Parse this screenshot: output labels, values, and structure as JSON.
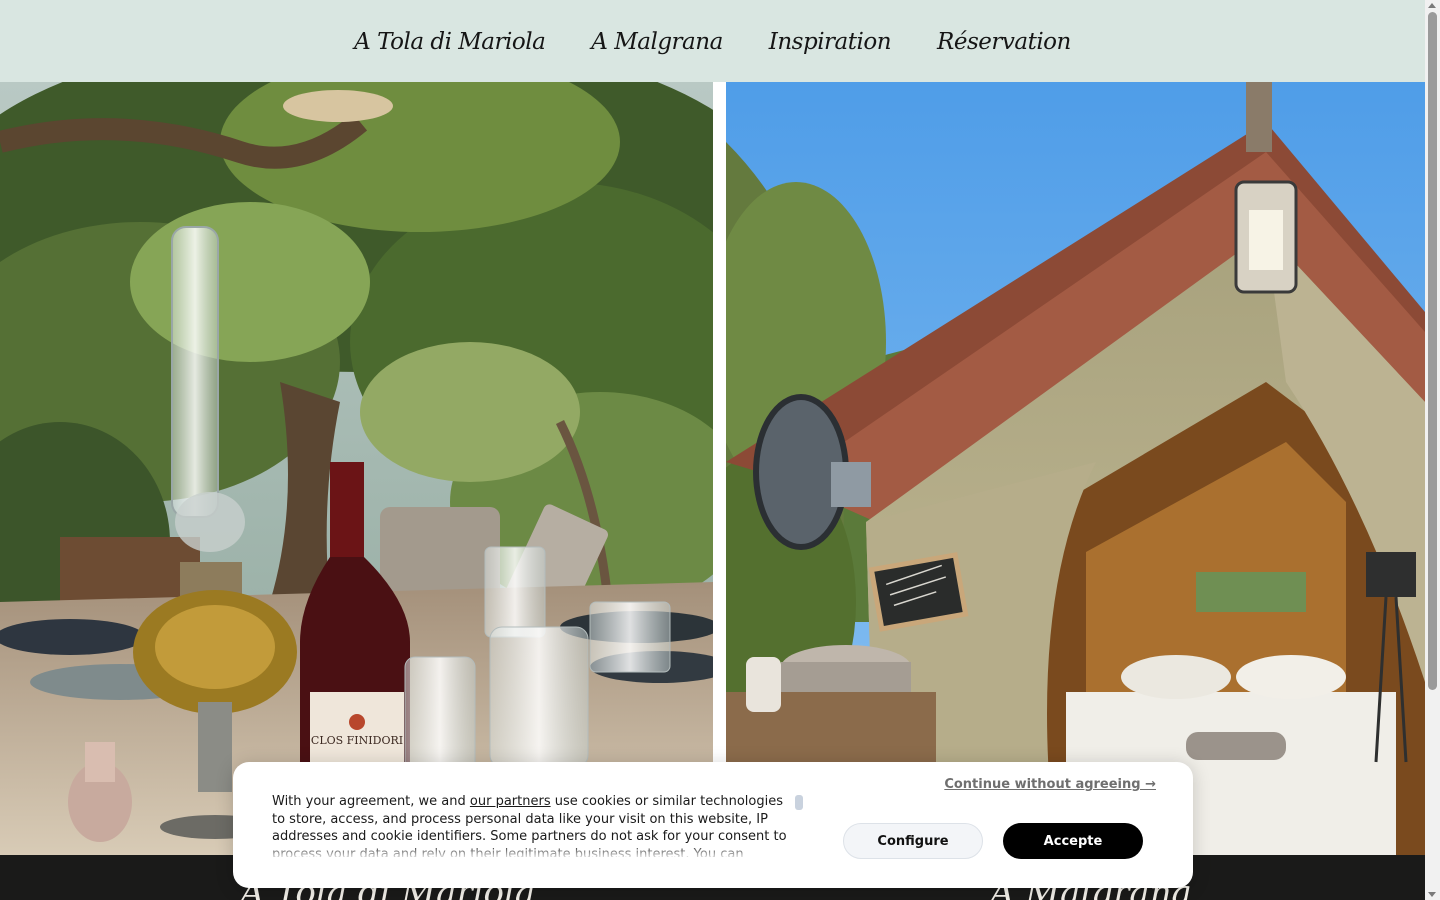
{
  "nav": {
    "items": [
      {
        "label": "A Tola di Mariola"
      },
      {
        "label": "A Malgrana"
      },
      {
        "label": "Inspiration"
      },
      {
        "label": "Réservation"
      }
    ]
  },
  "gallery": {
    "left_bottle_label": "CLOS FINIDORI",
    "left_title": "A Tola di Mariola",
    "right_title": "A Malgrana"
  },
  "consent": {
    "continue_label": "Continue without agreeing →",
    "text_before_link": "With your agreement, we and ",
    "partners_link": "our partners",
    "text_after_link": " use cookies or similar technologies to store, access, and process personal data like your visit on this website, IP addresses and cookie identifiers. Some partners do not ask for your consent to process your data and rely on their legitimate business interest. You can",
    "configure_label": "Configure",
    "accept_label": "Accepte"
  },
  "colors": {
    "nav_background": "#d9e6e1",
    "accept_button": "#000000",
    "configure_button": "#f3f5f8"
  }
}
